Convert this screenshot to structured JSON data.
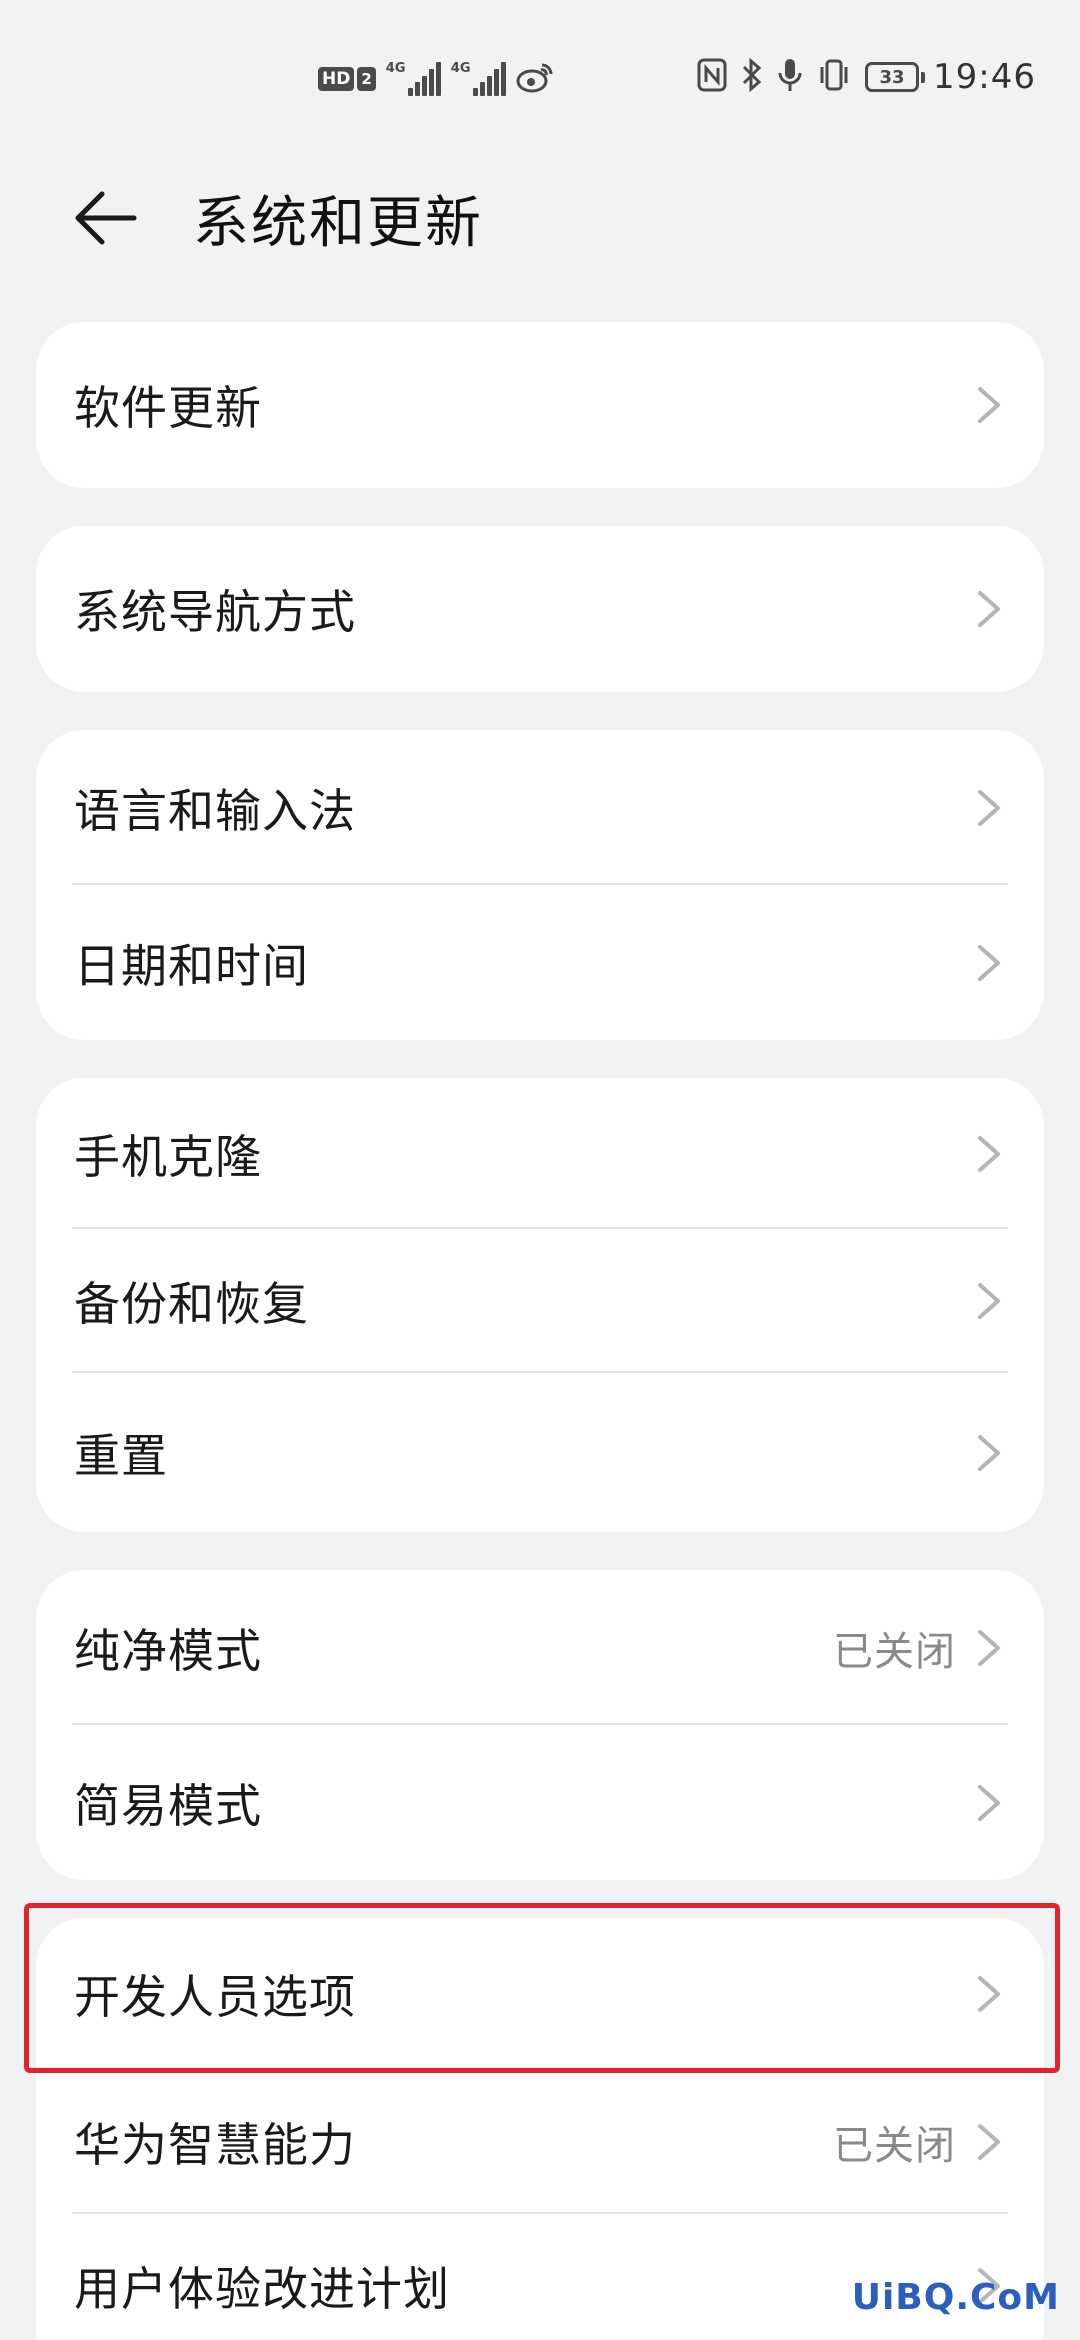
{
  "status_bar": {
    "hd_label": "HD",
    "sim_number": "2",
    "sim1_network": "4G",
    "sim2_network": "4G",
    "battery": "33",
    "time": "19:46",
    "icons": [
      "nfc-icon",
      "bluetooth-icon",
      "microphone-icon",
      "vibrate-icon"
    ]
  },
  "header": {
    "title": "系统和更新"
  },
  "groups": [
    {
      "items": [
        {
          "label": "软件更新"
        }
      ]
    },
    {
      "items": [
        {
          "label": "系统导航方式"
        }
      ]
    },
    {
      "items": [
        {
          "label": "语言和输入法"
        },
        {
          "label": "日期和时间"
        }
      ]
    },
    {
      "items": [
        {
          "label": "手机克隆"
        },
        {
          "label": "备份和恢复"
        },
        {
          "label": "重置"
        }
      ]
    },
    {
      "items": [
        {
          "label": "纯净模式",
          "value": "已关闭"
        },
        {
          "label": "简易模式"
        }
      ]
    },
    {
      "items": [
        {
          "label": "开发人员选项"
        },
        {
          "label": "华为智慧能力",
          "value": "已关闭"
        },
        {
          "label": "用户体验改进计划"
        }
      ]
    }
  ],
  "highlighted_item": "开发人员选项",
  "watermark": "UiBQ.CoM",
  "colors": {
    "background": "#f1f2f4",
    "card": "#ffffff",
    "highlight": "#e0252a",
    "chevron": "#b5b5b5",
    "value_text": "#8a8a8a"
  }
}
